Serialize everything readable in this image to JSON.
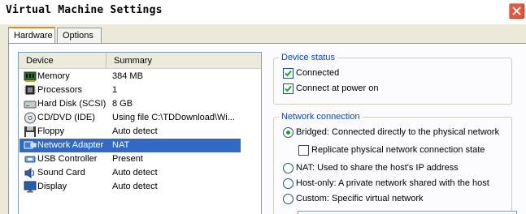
{
  "window": {
    "title": "Virtual Machine Settings",
    "close_icon": "close-icon"
  },
  "tabs": [
    {
      "label": "Hardware",
      "active": true
    },
    {
      "label": "Options",
      "active": false
    }
  ],
  "device_list": {
    "columns": [
      "Device",
      "Summary"
    ],
    "rows": [
      {
        "device": "Memory",
        "summary": "384 MB",
        "icon": "memory-icon"
      },
      {
        "device": "Processors",
        "summary": "1",
        "icon": "processor-icon"
      },
      {
        "device": "Hard Disk (SCSI)",
        "summary": "8 GB",
        "icon": "hard-disk-icon"
      },
      {
        "device": "CD/DVD (IDE)",
        "summary": "Using file C:\\TDDownload\\Wi...",
        "icon": "cd-dvd-icon"
      },
      {
        "device": "Floppy",
        "summary": "Auto detect",
        "icon": "floppy-icon"
      },
      {
        "device": "Network Adapter",
        "summary": "NAT",
        "icon": "network-adapter-icon",
        "selected": true
      },
      {
        "device": "USB Controller",
        "summary": "Present",
        "icon": "usb-icon"
      },
      {
        "device": "Sound Card",
        "summary": "Auto detect",
        "icon": "sound-card-icon"
      },
      {
        "device": "Display",
        "summary": "Auto detect",
        "icon": "display-icon"
      }
    ]
  },
  "device_status": {
    "legend": "Device status",
    "connected": {
      "label": "Connected",
      "checked": true
    },
    "connect_at_power_on": {
      "label": "Connect at power on",
      "checked": true
    }
  },
  "network_connection": {
    "legend": "Network connection",
    "bridged": {
      "label": "Bridged: Connected directly to the physical network",
      "selected": true
    },
    "replicate": {
      "label": "Replicate physical network connection state",
      "checked": false
    },
    "nat": {
      "label": "NAT: Used to share the host's IP address",
      "selected": false
    },
    "host_only": {
      "label": "Host-only: A private network shared with the host",
      "selected": false
    },
    "custom": {
      "label": "Custom: Specific virtual network",
      "selected": false
    }
  },
  "colors": {
    "selection": "#316ac5",
    "group_legend": "#0046d5",
    "radio_dot": "#21a121",
    "check_mark": "#21a121",
    "close_button": "#e2583e"
  }
}
